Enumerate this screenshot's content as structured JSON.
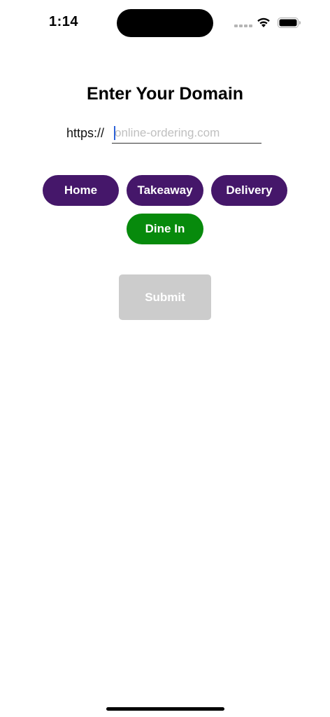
{
  "status_bar": {
    "time": "1:14",
    "icons": [
      "cellular-signal-icon",
      "wifi-icon",
      "battery-icon"
    ]
  },
  "page": {
    "title": "Enter Your Domain"
  },
  "domain": {
    "prefix": "https://",
    "value": "",
    "placeholder": "online-ordering.com"
  },
  "order_types": [
    {
      "label": "Home",
      "color": "#45176A",
      "selected": false
    },
    {
      "label": "Takeaway",
      "color": "#45176A",
      "selected": false
    },
    {
      "label": "Delivery",
      "color": "#45176A",
      "selected": false
    },
    {
      "label": "Dine In",
      "color": "#078A0C",
      "selected": true
    }
  ],
  "submit": {
    "label": "Submit",
    "enabled": false,
    "color": "#CCCCCC"
  }
}
